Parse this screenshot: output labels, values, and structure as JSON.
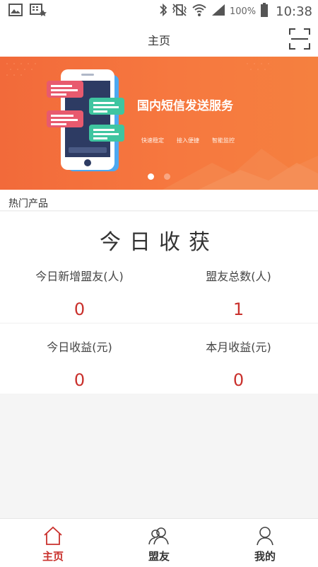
{
  "status_bar": {
    "left_icons": [
      "image-icon",
      "keyboard-icon"
    ],
    "right_icons": [
      "bluetooth-icon",
      "vibrate-icon",
      "wifi-icon",
      "signal-icon",
      "battery-icon"
    ],
    "battery": "100%",
    "time": "10:38"
  },
  "header": {
    "title": "主页",
    "scan_icon": "scan-icon"
  },
  "banner": {
    "title": "国内短信发送服务",
    "tags": [
      "快速稳定",
      "接入便捷",
      "智能监控"
    ],
    "slide_count": 2,
    "active_slide": 0,
    "colors": {
      "background": "#f26a3a",
      "bubble_red": "#e85a6e",
      "bubble_green": "#3fc5a0"
    }
  },
  "hot_products": {
    "label": "热门产品"
  },
  "earnings": {
    "title": "今日收获",
    "stats": [
      {
        "label": "今日新增盟友(人)",
        "value": "0"
      },
      {
        "label": "盟友总数(人)",
        "value": "1"
      },
      {
        "label": "今日收益(元)",
        "value": "0"
      },
      {
        "label": "本月收益(元)",
        "value": "0"
      }
    ],
    "value_color": "#c9302c"
  },
  "tabbar": {
    "tabs": [
      {
        "label": "主页",
        "icon": "home-icon",
        "active": true
      },
      {
        "label": "盟友",
        "icon": "friends-icon",
        "active": false
      },
      {
        "label": "我的",
        "icon": "profile-icon",
        "active": false
      }
    ],
    "active_color": "#c9302c"
  }
}
